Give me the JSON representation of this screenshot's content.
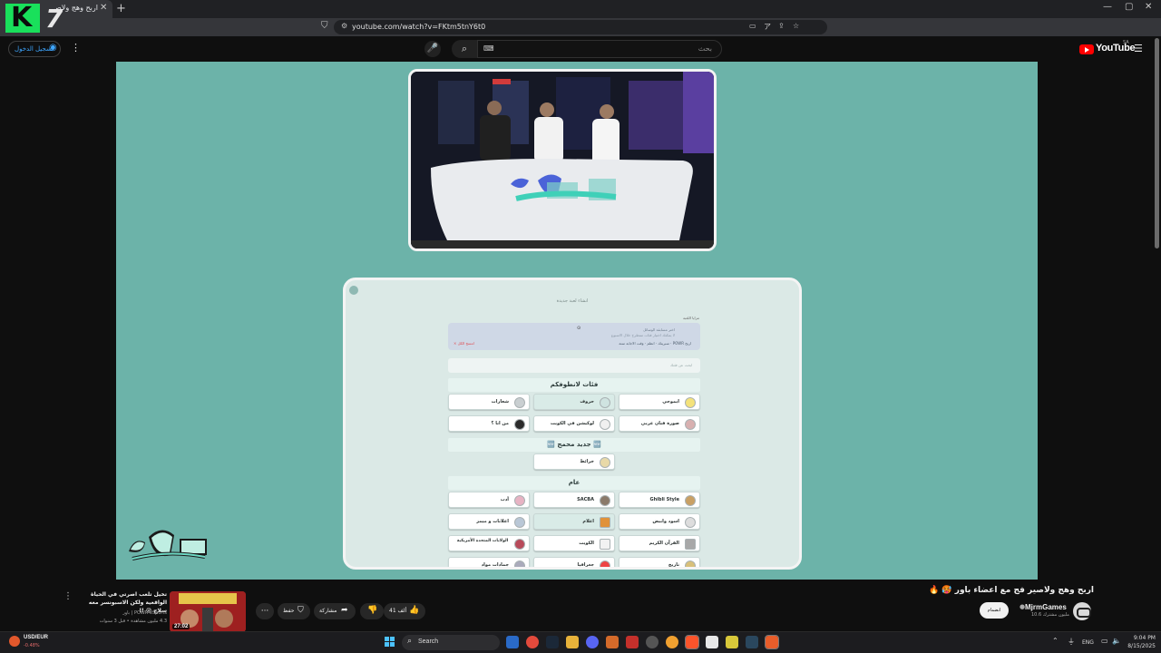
{
  "browser": {
    "tab_title": "اربح وهج ولاصير فج مع اعضاء باور",
    "tab_close_icon": "close-icon",
    "url": "youtube.com/watch?v=FKtm5tnY6t0"
  },
  "overlay_logo": {
    "letter": "K",
    "number": "7",
    "accent": "#19e05b"
  },
  "youtube_header": {
    "sign_in_label": "تسجيل الدخول",
    "search_placeholder": "بحث",
    "logo_text": "YouTube",
    "region": "SA"
  },
  "game": {
    "title": "انشاء لعبة جديدة",
    "settings_label": "مزايا اللعبة",
    "settings_line1": "اختر مسابقة الوسائل",
    "settings_line2": "لا يمكنك اختيار فئات ستطرح خلال الاسبوع",
    "settings_options": "اربح POWR · سبرينك · انظم · وقت الاجابة ستة",
    "settings_reset": "× امسح الكل",
    "search_placeholder": "ابحث عن فئتك",
    "sections": [
      {
        "title": "فئات لانطوفكم",
        "items": [
          "ايموجي",
          "حروف",
          "شعارات",
          "صورة فنان عربي",
          "لوكيشن في الكويت",
          "من انا ؟"
        ]
      },
      {
        "title": "🆕 جديد محمج 🆕",
        "items": [
          "خرائط"
        ]
      },
      {
        "title": "عام",
        "items": [
          "Ghibli Style",
          "SACBA",
          "أدب",
          "اسود وابيض",
          "اعلام",
          "اعلانات و ميمز",
          "القرآن الكريم",
          "الكويت",
          "الولايات المتحدة الأمريكية",
          "تاريخ",
          "جغرافيا",
          "جمادات مواد"
        ]
      }
    ]
  },
  "video_info": {
    "title": "اربح وهج ولاصير فج مع اعضاء باور 🥵 🔥",
    "channel_name": "MjrmGames",
    "subscribers": "10.6 مليون مشترك",
    "join_label": "انضمام",
    "like_count": "41 ألف",
    "share_label": "مشاركة",
    "save_label": "حفظ"
  },
  "recommended": {
    "title": "تخيل تلعب اصرتي في الحياة الواقعية ولكن الاسبونسر معه سلاح 😰 !!",
    "channel": "POWR eSports | باور",
    "meta": "4.3 مليون مشاهدة • قبل 3 سنوات",
    "duration": "27:02"
  },
  "taskbar": {
    "ticker_name": "USD/EUR",
    "ticker_value": "-0.48%",
    "search_label": "Search",
    "language": "ENG",
    "time": "9:04 PM",
    "date": "8/15/2025"
  }
}
